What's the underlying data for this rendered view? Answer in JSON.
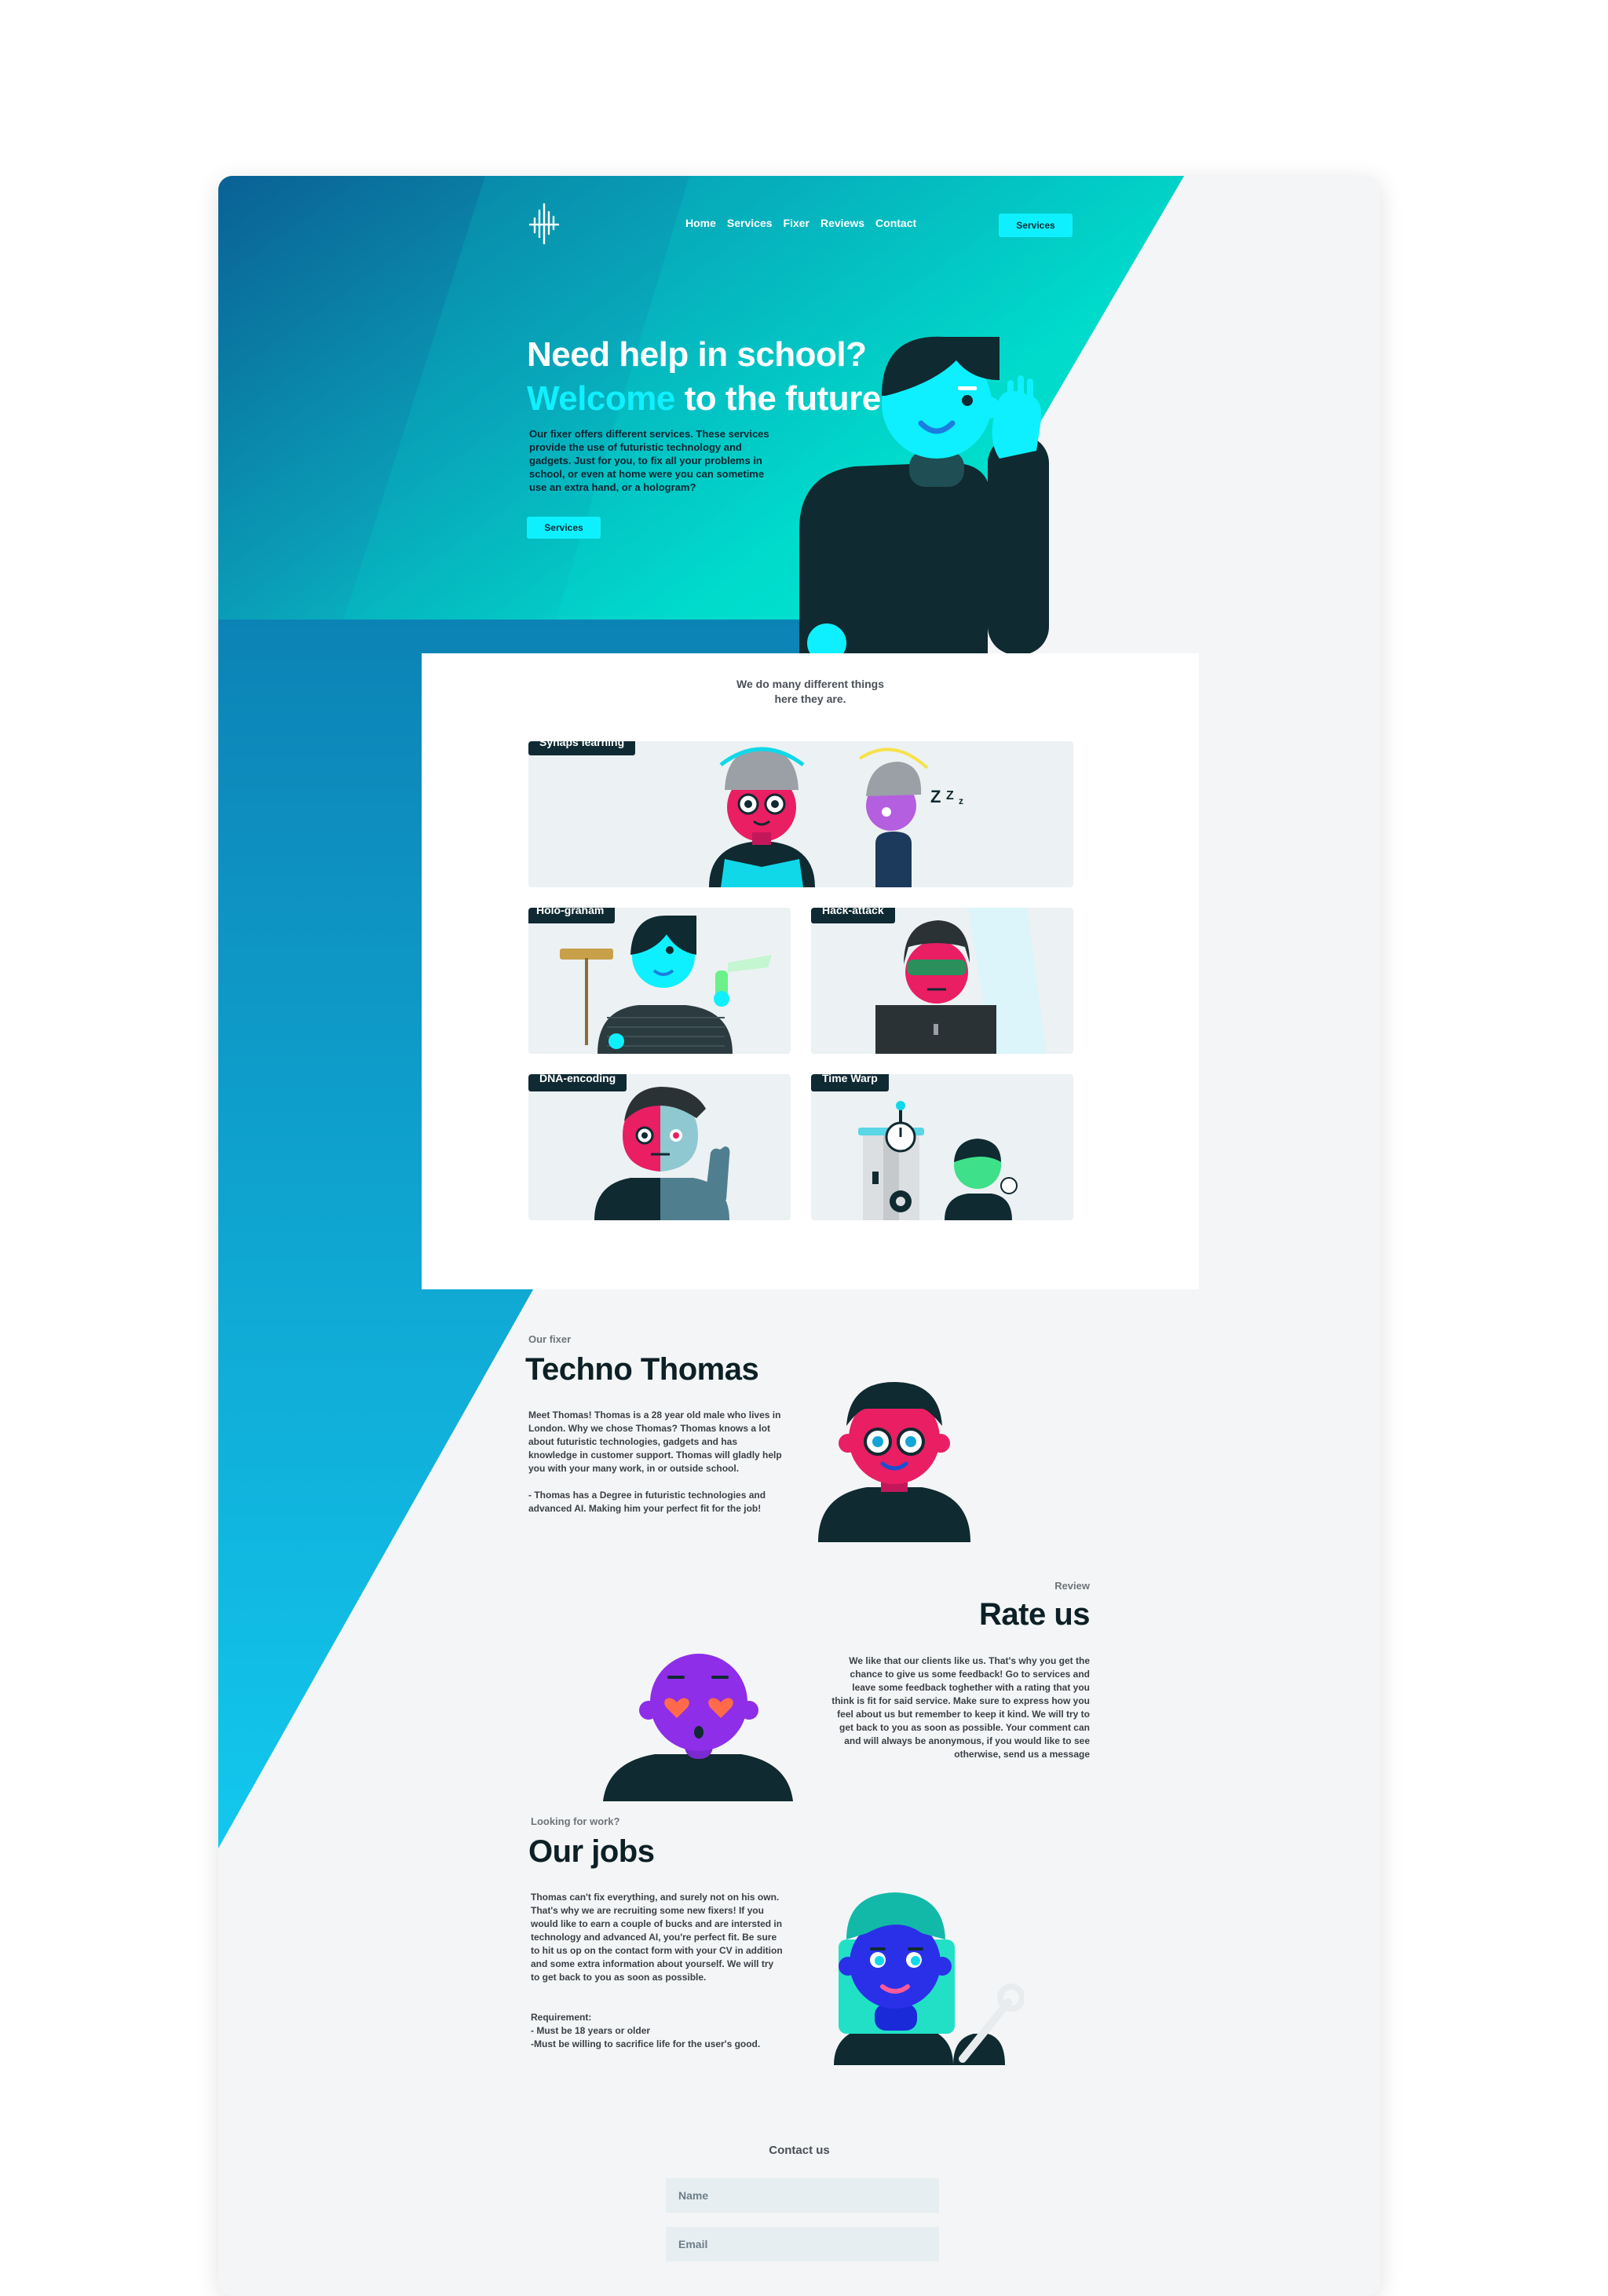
{
  "nav": {
    "items": [
      "Home",
      "Services",
      "Fixer",
      "Reviews",
      "Contact"
    ],
    "cta_label": "Services"
  },
  "hero": {
    "title_line1": "Need help in school?",
    "title_accent": "Welcome",
    "title_rest": " to the future.",
    "text": "Our fixer offers different services. These services provide the use of futuristic technology and gadgets. Just for you, to fix all your problems in school, or even at home were you can sometime use an extra hand, or a hologram?",
    "button_label": "Services"
  },
  "services": {
    "heading_line1": "We do many different things",
    "heading_line2": "here they are.",
    "tiles": [
      {
        "label": "Synaps learning"
      },
      {
        "label": "Holo-graham"
      },
      {
        "label": "Hack-attack"
      },
      {
        "label": "DNA-encoding"
      },
      {
        "label": "Time Warp"
      }
    ]
  },
  "fixer": {
    "eyebrow": "Our fixer",
    "title": "Techno Thomas",
    "text1": "Meet Thomas! Thomas is a 28 year old male who lives in London. Why we chose Thomas? Thomas knows a lot about futuristic technologies, gadgets and has knowledge in customer support. Thomas will gladly help you with your many work, in or outside school.",
    "text2": "- Thomas has a Degree in futuristic technologies and advanced AI. Making him your perfect fit for the job!"
  },
  "review": {
    "eyebrow": "Review",
    "title": "Rate us",
    "text": "We like that our clients like us. That's why you get the chance to give us some feedback! Go to services and leave some feedback toghether with a rating that you think is fit for said service. Make sure to express how you feel about us but remember to keep it kind. We will try to get back to you as soon as possible. Your comment can and will always be anonymous, if you would like to see otherwise, send us a message"
  },
  "jobs": {
    "eyebrow": "Looking for work?",
    "title": "Our jobs",
    "text": "Thomas can't fix everything, and surely not on his own. That's why we are recruiting some new fixers! If you would like to earn a couple of bucks and are intersted in technology and advanced AI, you're perfect fit. Be sure to hit us op on the contact form with your CV in addition and some extra information about yourself. We will try to get back to you as soon as possible.",
    "req_title": "Requirement:",
    "req1": "- Must be 18 years or older",
    "req2": "-Must be willing to sacrifice life for the user's good."
  },
  "contact": {
    "title": "Contact us",
    "name_placeholder": "Name",
    "email_placeholder": "Email"
  },
  "colors": {
    "accent": "#0ff0ff",
    "dark": "#102a33",
    "teal": "#00e6c8",
    "blue": "#0f7fb4"
  }
}
